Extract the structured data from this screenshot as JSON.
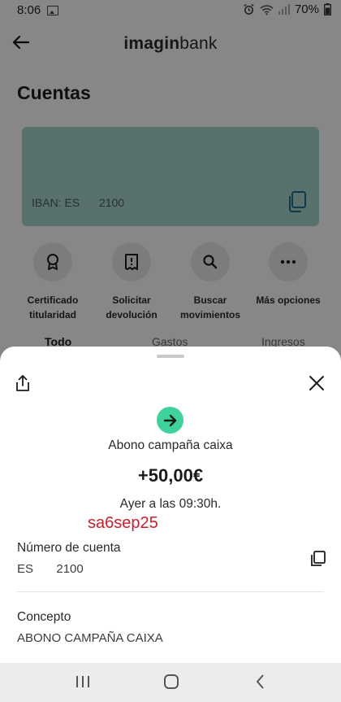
{
  "status_bar": {
    "time": "8:06",
    "battery": "70%",
    "icons": [
      "image-icon",
      "alarm-icon",
      "wifi-icon",
      "signal-icon",
      "battery-icon"
    ]
  },
  "header": {
    "logo_regular_1": "imagin",
    "logo_bold": "",
    "logo_regular_2": "bank",
    "back_icon": "arrow-left-icon"
  },
  "page": {
    "title": "Cuentas"
  },
  "account_card": {
    "iban_label": "IBAN: ES",
    "iban_number": "2100",
    "background": "#a7d6cd",
    "copy_icon": "copy-icon"
  },
  "quick_actions": [
    {
      "icon": "certificate-icon",
      "line1": "Certificado",
      "line2": "titularidad"
    },
    {
      "icon": "receipt-icon",
      "line1": "Solicitar",
      "line2": "devolución"
    },
    {
      "icon": "search-icon",
      "line1": "Buscar",
      "line2": "movimientos"
    },
    {
      "icon": "more-icon",
      "line1": "Más opciones",
      "line2": ""
    }
  ],
  "tabs": [
    "Todo",
    "Gastos",
    "Ingresos"
  ],
  "transaction": {
    "description": "Abono campaña caixa",
    "amount": "+50,00€",
    "date": "Ayer a las 09:30h.",
    "annotation": "sa6sep25",
    "account_label": "Número de cuenta",
    "account_prefix": "ES",
    "account_number": "2100",
    "concept_label": "Concepto",
    "concept_value": "ABONO CAMPAÑA CAIXA",
    "icon_color": "#3dd39a",
    "annotation_color": "#cc1f2a"
  },
  "nav": {
    "icons": [
      "recent-apps-icon",
      "home-icon",
      "back-icon"
    ]
  }
}
